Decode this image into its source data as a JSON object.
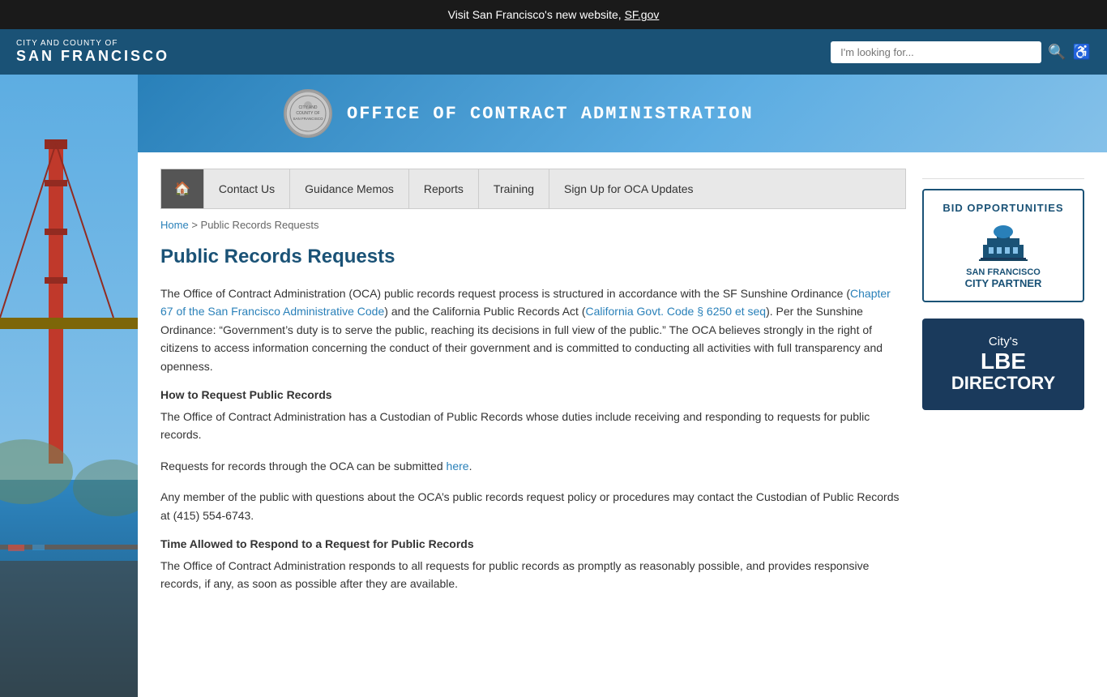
{
  "topBanner": {
    "text": "Visit San Francisco's new website, ",
    "linkText": "SF.gov",
    "linkUrl": "https://sf.gov"
  },
  "header": {
    "cityLabel": "City and County of",
    "cityName": "San Francisco",
    "searchPlaceholder": "I'm looking for...",
    "searchIconLabel": "🔍",
    "accessIconLabel": "♿"
  },
  "deptHeader": {
    "title": "Office of Contract Administration"
  },
  "nav": {
    "homeIcon": "🏠",
    "items": [
      {
        "label": "Contact Us"
      },
      {
        "label": "Guidance Memos"
      },
      {
        "label": "Reports"
      },
      {
        "label": "Training"
      },
      {
        "label": "Sign Up for OCA Updates"
      }
    ]
  },
  "breadcrumb": {
    "homeLabel": "Home",
    "separator": ">",
    "currentLabel": "Public Records Requests"
  },
  "page": {
    "title": "Public Records Requests",
    "intro": "The Office of Contract Administration (OCA) public records request process is structured in accordance with the SF Sunshine Ordinance (",
    "link1Text": "Chapter 67 of the San Francisco Administrative Code",
    "introMid": ") and the California Public Records Act (",
    "link2Text": "California Govt. Code § 6250 et seq",
    "introEnd": "). Per the Sunshine Ordinance: “Government’s duty is to serve the public, reaching its decisions in full view of the public.” The OCA believes strongly in the right of citizens to access information concerning the conduct of their government and is committed to conducting all activities with full transparency and openness.",
    "section1Heading": "How to Request Public Records",
    "section1Para1": "The Office of Contract Administration has a Custodian of Public Records whose duties include receiving and responding to requests for public records.",
    "section1Para2Start": "Requests for records through the OCA can be submitted ",
    "section1Para2Link": "here",
    "section1Para2End": ".",
    "section1Para3": "Any member of the public with questions about the OCA’s public records request policy or procedures may contact the Custodian of Public Records at (415) 554-6743.",
    "section2Heading": "Time Allowed to Respond to a Request for Public Records",
    "section2Para": "The Office of Contract Administration responds to all requests for public records as promptly as reasonably possible, and provides responsive records, if any, as soon as possible after they are available."
  },
  "sidebar": {
    "bidOpportunities": {
      "title": "BID OPPORTUNITIES",
      "sfLabel": "SAN FRANCISCO",
      "cityPartner": "CITY PARTNER"
    },
    "lbeDirectory": {
      "citysLabel": "City's",
      "lbeLabel": "LBE",
      "directoryLabel": "DIRECTORY"
    }
  }
}
